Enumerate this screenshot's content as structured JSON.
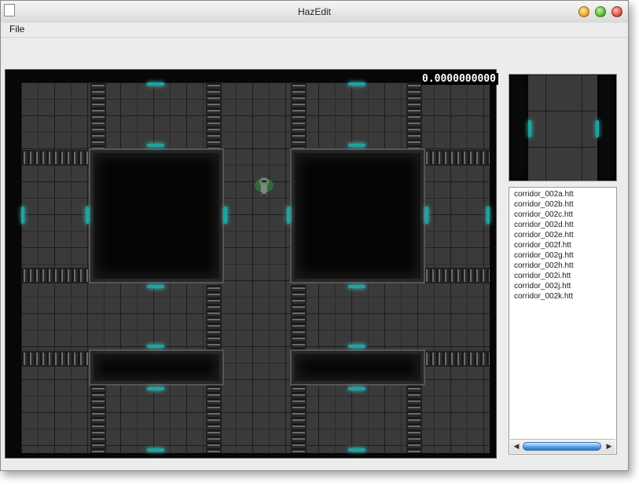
{
  "window": {
    "title": "HazEdit"
  },
  "menu": {
    "file_label": "File"
  },
  "canvas": {
    "timer_text": "0.0000000000"
  },
  "file_list": {
    "items": [
      "corridor_002a.htt",
      "corridor_002b.htt",
      "corridor_002c.htt",
      "corridor_002d.htt",
      "corridor_002e.htt",
      "corridor_002f.htt",
      "corridor_002g.htt",
      "corridor_002h.htt",
      "corridor_002i.htt",
      "corridor_002j.htt",
      "corridor_002k.htt"
    ]
  },
  "icons": {
    "window_icon": "document-icon",
    "minimize": "minimize-icon",
    "zoom": "zoom-icon",
    "close": "close-icon",
    "player": "player-sprite-icon",
    "scroll_left": "arrow-left-icon",
    "scroll_right": "arrow-right-icon"
  },
  "colors": {
    "door_glow": "#1fa3a0",
    "floor": "#3a3a3a",
    "scroll_thumb": "#5aa2ea"
  }
}
